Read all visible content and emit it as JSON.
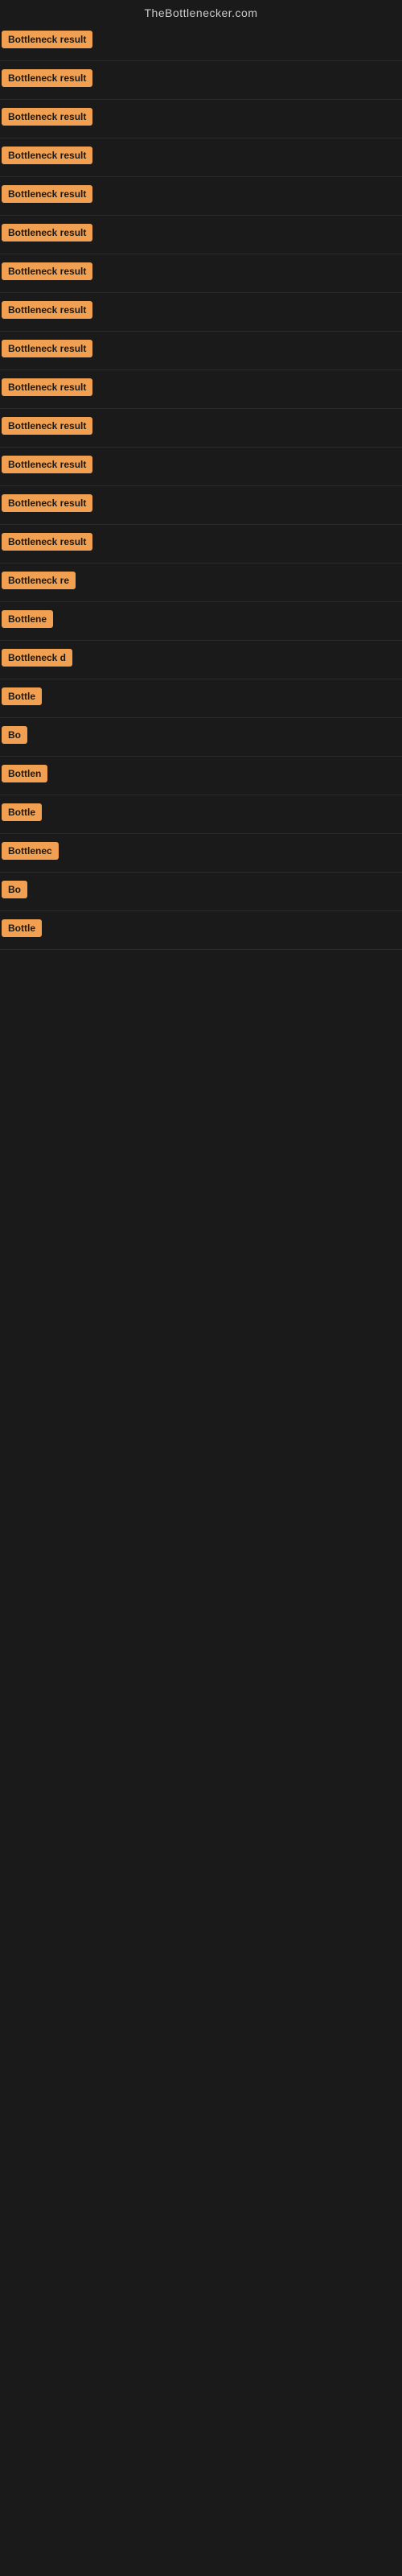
{
  "site": {
    "title": "TheBottlenecker.com"
  },
  "badges": [
    {
      "label": "Bottleneck result",
      "width": "full"
    },
    {
      "label": "Bottleneck result",
      "width": "full"
    },
    {
      "label": "Bottleneck result",
      "width": "full"
    },
    {
      "label": "Bottleneck result",
      "width": "full"
    },
    {
      "label": "Bottleneck result",
      "width": "full"
    },
    {
      "label": "Bottleneck result",
      "width": "full"
    },
    {
      "label": "Bottleneck result",
      "width": "full"
    },
    {
      "label": "Bottleneck result",
      "width": "full"
    },
    {
      "label": "Bottleneck result",
      "width": "full"
    },
    {
      "label": "Bottleneck result",
      "width": "full"
    },
    {
      "label": "Bottleneck result",
      "width": "full"
    },
    {
      "label": "Bottleneck result",
      "width": "full"
    },
    {
      "label": "Bottleneck result",
      "width": "full"
    },
    {
      "label": "Bottleneck result",
      "width": "full"
    },
    {
      "label": "Bottleneck re",
      "width": "partial"
    },
    {
      "label": "Bottlene",
      "width": "partial"
    },
    {
      "label": "Bottleneck d",
      "width": "partial"
    },
    {
      "label": "Bottle",
      "width": "partial"
    },
    {
      "label": "Bo",
      "width": "partial"
    },
    {
      "label": "Bottlen",
      "width": "partial"
    },
    {
      "label": "Bottle",
      "width": "partial"
    },
    {
      "label": "Bottlenec",
      "width": "partial"
    },
    {
      "label": "Bo",
      "width": "partial"
    },
    {
      "label": "Bottle",
      "width": "partial"
    }
  ]
}
